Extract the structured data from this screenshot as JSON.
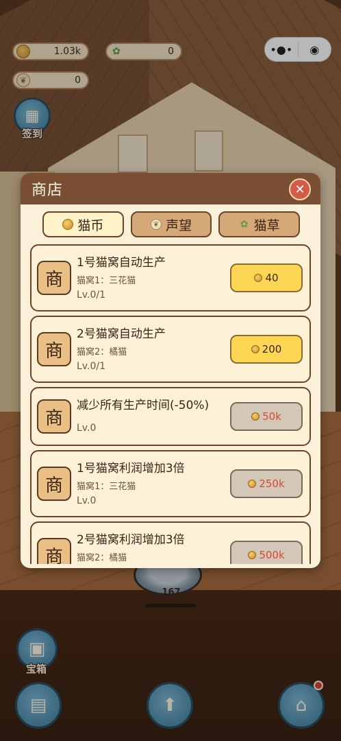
{
  "hud": {
    "coins": "1.03k",
    "catnip": "0",
    "prestige": "0"
  },
  "capsule": {
    "menu_glyph": "•●•",
    "close_glyph": "◉"
  },
  "left_buttons": {
    "checkin_label": "签到",
    "treasure_label": "宝箱"
  },
  "scene": {
    "cat_bed_count": "167"
  },
  "shop": {
    "title": "商店",
    "close_glyph": "✕",
    "icon_char": "商",
    "tabs": [
      {
        "label": "猫币",
        "icon": "coin-icon",
        "active": true
      },
      {
        "label": "声望",
        "icon": "laurel-icon",
        "active": false
      },
      {
        "label": "猫草",
        "icon": "grass-icon",
        "active": false
      }
    ],
    "items": [
      {
        "title": "1号猫窝自动生产",
        "sub": "猫窝1：三花猫",
        "level": "Lv.0/1",
        "price": "40",
        "state": "available"
      },
      {
        "title": "2号猫窝自动生产",
        "sub": "猫窝2：橘猫",
        "level": "Lv.0/1",
        "price": "200",
        "state": "available"
      },
      {
        "title": "减少所有生产时间(-50%)",
        "sub": "",
        "level": "Lv.0",
        "price": "50k",
        "state": "locked"
      },
      {
        "title": "1号猫窝利润增加3倍",
        "sub": "猫窝1：三花猫",
        "level": "Lv.0",
        "price": "250k",
        "state": "locked"
      },
      {
        "title": "2号猫窝利润增加3倍",
        "sub": "猫窝2：橘猫",
        "level": "",
        "price": "500k",
        "state": "locked"
      }
    ]
  },
  "colors": {
    "header_brown": "#7a4e33",
    "panel_cream": "#fbf0d9",
    "price_available": "#fdd653",
    "price_locked": "#d3c7b8",
    "price_locked_text": "#d44a32",
    "close_red": "#d25b46"
  }
}
